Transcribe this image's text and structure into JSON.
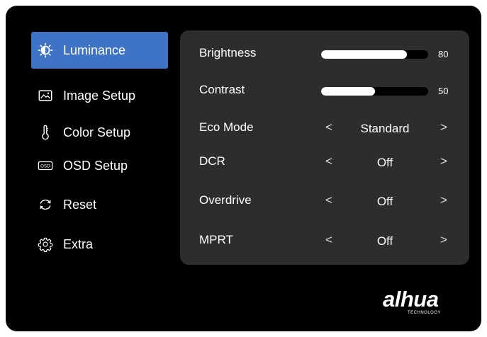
{
  "sidebar": {
    "items": [
      {
        "label": "Luminance",
        "icon": "brightness-icon",
        "active": true
      },
      {
        "label": "Image Setup",
        "icon": "image-icon",
        "active": false
      },
      {
        "label": "Color Setup",
        "icon": "thermometer-icon",
        "active": false
      },
      {
        "label": "OSD Setup",
        "icon": "osd-icon",
        "active": false
      },
      {
        "label": "Reset",
        "icon": "reset-icon",
        "active": false
      },
      {
        "label": "Extra",
        "icon": "gear-icon",
        "active": false
      }
    ],
    "active_color": "#3f73c6"
  },
  "panel": {
    "sliders": [
      {
        "label": "Brightness",
        "value": "80",
        "percent": 80
      },
      {
        "label": "Contrast",
        "value": "50",
        "percent": 50
      }
    ],
    "options": [
      {
        "label": "Eco Mode",
        "value": "Standard"
      },
      {
        "label": "DCR",
        "value": "Off"
      },
      {
        "label": "Overdrive",
        "value": "Off"
      },
      {
        "label": "MPRT",
        "value": "Off"
      }
    ],
    "left_arrow": "<",
    "right_arrow": ">"
  },
  "brand": {
    "logo": "alhua",
    "tagline": "TECHNOLOGY"
  }
}
